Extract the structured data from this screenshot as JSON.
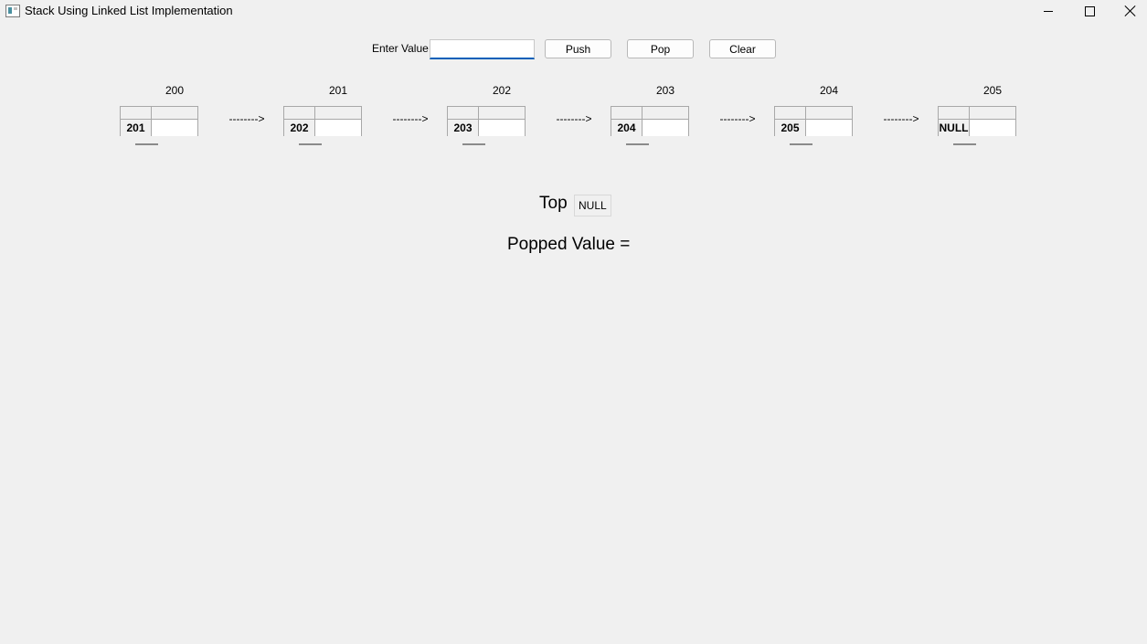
{
  "window": {
    "title": "Stack Using Linked List Implementation",
    "icon": "app-window-icon"
  },
  "controls": {
    "input_label": "Enter Value:",
    "input_value": "",
    "input_placeholder": "",
    "push_label": "Push",
    "pop_label": "Pop",
    "clear_label": "Clear"
  },
  "nodes": [
    {
      "address": "200",
      "next": "201",
      "data": ""
    },
    {
      "address": "201",
      "next": "202",
      "data": ""
    },
    {
      "address": "202",
      "next": "203",
      "data": ""
    },
    {
      "address": "203",
      "next": "204",
      "data": ""
    },
    {
      "address": "204",
      "next": "205",
      "data": ""
    },
    {
      "address": "205",
      "next": "NULL",
      "data": ""
    }
  ],
  "arrows": [
    "-------->",
    "-------->",
    "-------->",
    "-------->",
    "-------->"
  ],
  "status": {
    "top_label": "Top",
    "top_value": "NULL",
    "popped_label": "Popped Value ="
  },
  "colors": {
    "background": "#f0f0f0",
    "input_focus_border": "#005fb8"
  }
}
